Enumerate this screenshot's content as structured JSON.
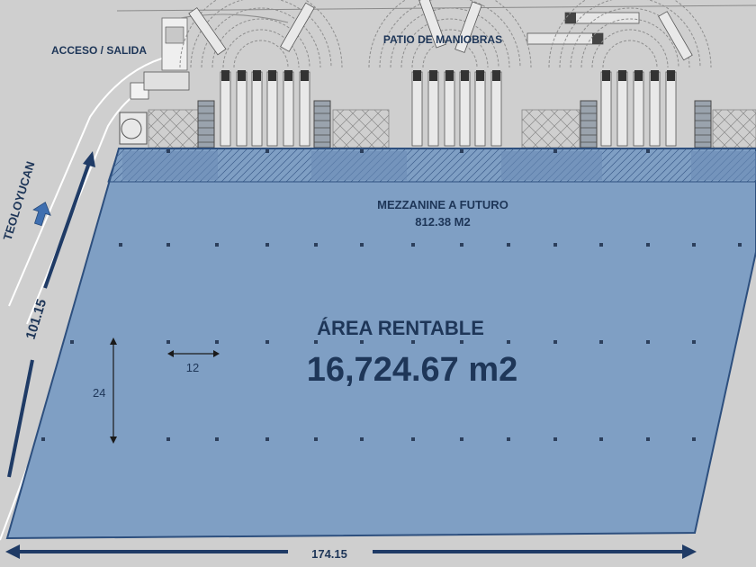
{
  "labels": {
    "access": "ACCESO / SALIDA",
    "yard": "PATIO DE MANIOBRAS",
    "road": "TEOLOYUCAN",
    "mezzanine_title": "MEZZANINE A FUTURO",
    "mezzanine_area": "812.38 M2",
    "rentable_title": "ÁREA RENTABLE",
    "rentable_area": "16,724.67 m2",
    "dim_side": "101.15",
    "dim_bottom": "174.15",
    "dim_bay_width": "12",
    "dim_bay_depth": "24"
  },
  "colors": {
    "background": "#cfcfcf",
    "floor_fill": "#7f9fc4",
    "floor_stroke": "#2d4f7e",
    "mezzanine_fill": "#6e8fba",
    "arrow": "#1f3b66",
    "text": "#1e3658"
  },
  "icons": [
    "north-arrow-icon",
    "truck-icon",
    "dock-door-icon"
  ]
}
